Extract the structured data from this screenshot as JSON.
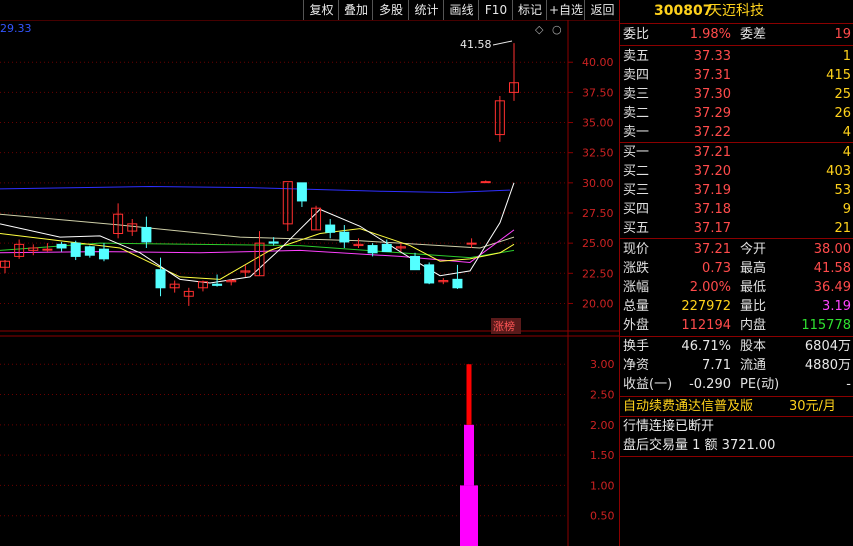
{
  "toolbar": {
    "items": [
      "复权",
      "叠加",
      "多股",
      "统计",
      "画线",
      "F10",
      "标记",
      "+自选",
      "返回"
    ]
  },
  "main_chart": {
    "corner_value": "29.33",
    "peak_label": "41.58",
    "badge": "涨榜",
    "price_axis": [
      "40.00",
      "37.50",
      "35.00",
      "32.50",
      "30.00",
      "27.50",
      "25.00",
      "22.50",
      "20.00"
    ]
  },
  "sub_chart": {
    "axis": [
      "3.00",
      "2.50",
      "2.00",
      "1.50",
      "1.00",
      "0.50"
    ]
  },
  "chart_data": [
    {
      "type": "candlestick",
      "ylim": [
        17.8,
        43.5
      ],
      "ohlc": [
        [
          23.0,
          23.6,
          22.5,
          23.5
        ],
        [
          23.9,
          25.3,
          23.7,
          24.9
        ],
        [
          24.4,
          24.9,
          24.0,
          24.6
        ],
        [
          24.5,
          25.0,
          24.3,
          24.5
        ],
        [
          24.9,
          25.1,
          24.3,
          24.6
        ],
        [
          25.0,
          25.2,
          23.6,
          23.9
        ],
        [
          24.7,
          24.8,
          23.8,
          24.0
        ],
        [
          24.5,
          25.0,
          23.5,
          23.7
        ],
        [
          25.8,
          28.3,
          25.4,
          27.4
        ],
        [
          26.0,
          27.0,
          25.6,
          26.6
        ],
        [
          26.3,
          27.2,
          24.6,
          25.1
        ],
        [
          22.8,
          23.8,
          20.6,
          21.3
        ],
        [
          21.3,
          21.9,
          20.9,
          21.6
        ],
        [
          20.6,
          21.3,
          19.8,
          21.0
        ],
        [
          21.3,
          21.9,
          21.0,
          21.8
        ],
        [
          21.6,
          22.4,
          21.4,
          21.5
        ],
        [
          21.8,
          22.0,
          21.5,
          21.9
        ],
        [
          22.6,
          23.2,
          22.2,
          22.7
        ],
        [
          22.3,
          26.0,
          22.3,
          25.0
        ],
        [
          25.1,
          25.5,
          24.8,
          25.0
        ],
        [
          26.6,
          30.0,
          26.0,
          30.1
        ],
        [
          30.0,
          30.0,
          28.0,
          28.5
        ],
        [
          26.1,
          28.1,
          26.1,
          27.9
        ],
        [
          26.5,
          27.0,
          25.4,
          25.9
        ],
        [
          25.9,
          26.5,
          24.6,
          25.1
        ],
        [
          24.8,
          25.4,
          24.6,
          24.9
        ],
        [
          24.8,
          25.0,
          23.9,
          24.2
        ],
        [
          24.9,
          25.3,
          24.6,
          24.3
        ],
        [
          24.6,
          25.0,
          24.3,
          24.7
        ],
        [
          23.9,
          24.2,
          22.8,
          22.8
        ],
        [
          23.2,
          23.4,
          21.6,
          21.7
        ],
        [
          21.8,
          22.1,
          21.6,
          21.9
        ],
        [
          22.0,
          23.2,
          21.2,
          21.3
        ],
        [
          25.0,
          25.4,
          24.6,
          25.0
        ],
        [
          30.1,
          30.2,
          30.0,
          30.1
        ],
        [
          34.0,
          37.2,
          33.4,
          36.8
        ],
        [
          37.5,
          41.58,
          36.8,
          38.3
        ]
      ]
    },
    {
      "type": "bar",
      "values_colored": [
        {
          "from": 0.0,
          "to": 1.0,
          "color": "#ff00ff"
        },
        {
          "from": 1.0,
          "to": 2.0,
          "color": "#ff00ff"
        },
        {
          "from": 2.0,
          "to": 3.0,
          "color": "#ff0000"
        }
      ],
      "ylim": [
        0,
        3.4
      ]
    }
  ],
  "panel": {
    "code": "300807",
    "name": "天迈科技",
    "weibi_label": "委比",
    "weibi": "1.98%",
    "weicha_label": "委差",
    "weicha": "19",
    "sells": [
      {
        "label": "卖五",
        "price": "37.33",
        "vol": "1"
      },
      {
        "label": "卖四",
        "price": "37.31",
        "vol": "415"
      },
      {
        "label": "卖三",
        "price": "37.30",
        "vol": "25"
      },
      {
        "label": "卖二",
        "price": "37.29",
        "vol": "26"
      },
      {
        "label": "卖一",
        "price": "37.22",
        "vol": "4"
      }
    ],
    "buys": [
      {
        "label": "买一",
        "price": "37.21",
        "vol": "4"
      },
      {
        "label": "买二",
        "price": "37.20",
        "vol": "403"
      },
      {
        "label": "买三",
        "price": "37.19",
        "vol": "53"
      },
      {
        "label": "买四",
        "price": "37.18",
        "vol": "9"
      },
      {
        "label": "买五",
        "price": "37.17",
        "vol": "21"
      }
    ],
    "stats": [
      {
        "l1": "现价",
        "v1": "37.21",
        "l2": "今开",
        "v2": "38.00"
      },
      {
        "l1": "涨跌",
        "v1": "0.73",
        "l2": "最高",
        "v2": "41.58"
      },
      {
        "l1": "涨幅",
        "v1": "2.00%",
        "l2": "最低",
        "v2": "36.49"
      },
      {
        "l1": "总量",
        "v1": "227972",
        "l2": "量比",
        "v2": "3.19"
      },
      {
        "l1": "外盘",
        "v1": "112194",
        "l2": "内盘",
        "v2": "115778"
      }
    ],
    "info": [
      {
        "l1": "换手",
        "v1": "46.71%",
        "l2": "股本",
        "v2": "6804万"
      },
      {
        "l1": "净资",
        "v1": "7.71",
        "l2": "流通",
        "v2": "4880万"
      },
      {
        "l1": "收益(一)",
        "v1": "-0.290",
        "l2": "PE(动)",
        "v2": "-"
      }
    ],
    "ad_text": "自动续费通达信普及版",
    "ad_price": "30元/月",
    "status": "行情连接已断开",
    "after_hours": "盘后交易量 1 额 3721.00"
  },
  "colors": {
    "up": "#ff3030",
    "down": "#54ffff",
    "border": "#8b0000"
  }
}
